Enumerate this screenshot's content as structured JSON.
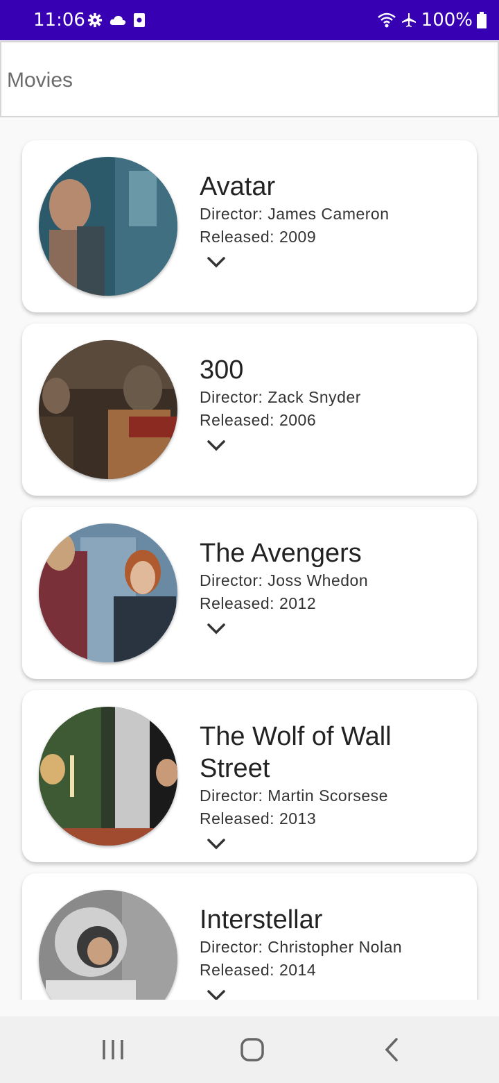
{
  "status_bar": {
    "time": "11:06",
    "battery": "100%",
    "left_icons": [
      "settings-icon",
      "cloud-icon",
      "screenshot-icon"
    ],
    "right_icons": [
      "wifi-icon",
      "airplane-icon",
      "battery-icon"
    ]
  },
  "app_bar": {
    "title": "Movies"
  },
  "movies": [
    {
      "title": "Avatar",
      "director": "Director: James Cameron",
      "released": "Released: 2009",
      "colors": [
        "#2c5a6a",
        "#8a7a6a"
      ]
    },
    {
      "title": "300",
      "director": "Director: Zack Snyder",
      "released": "Released: 2006",
      "colors": [
        "#3a2e25",
        "#a06a40"
      ]
    },
    {
      "title": "The Avengers",
      "director": "Director: Joss Whedon",
      "released": "Released: 2012",
      "colors": [
        "#6a8aa4",
        "#2a3340"
      ]
    },
    {
      "title": "The Wolf of Wall Street",
      "director": "Director: Martin Scorsese",
      "released": "Released: 2013",
      "colors": [
        "#2e3a2a",
        "#d8b070"
      ]
    },
    {
      "title": "Interstellar",
      "director": "Director: Christopher Nolan",
      "released": "Released: 2014",
      "colors": [
        "#8a8a8a",
        "#d0d0d0"
      ]
    }
  ],
  "expand_icon": "chevron-down-icon",
  "nav_bar": [
    "recents-icon",
    "home-icon",
    "back-icon"
  ],
  "colors": {
    "status_bar": "#3700b3",
    "card": "#ffffff",
    "background": "#f9f9f9"
  }
}
